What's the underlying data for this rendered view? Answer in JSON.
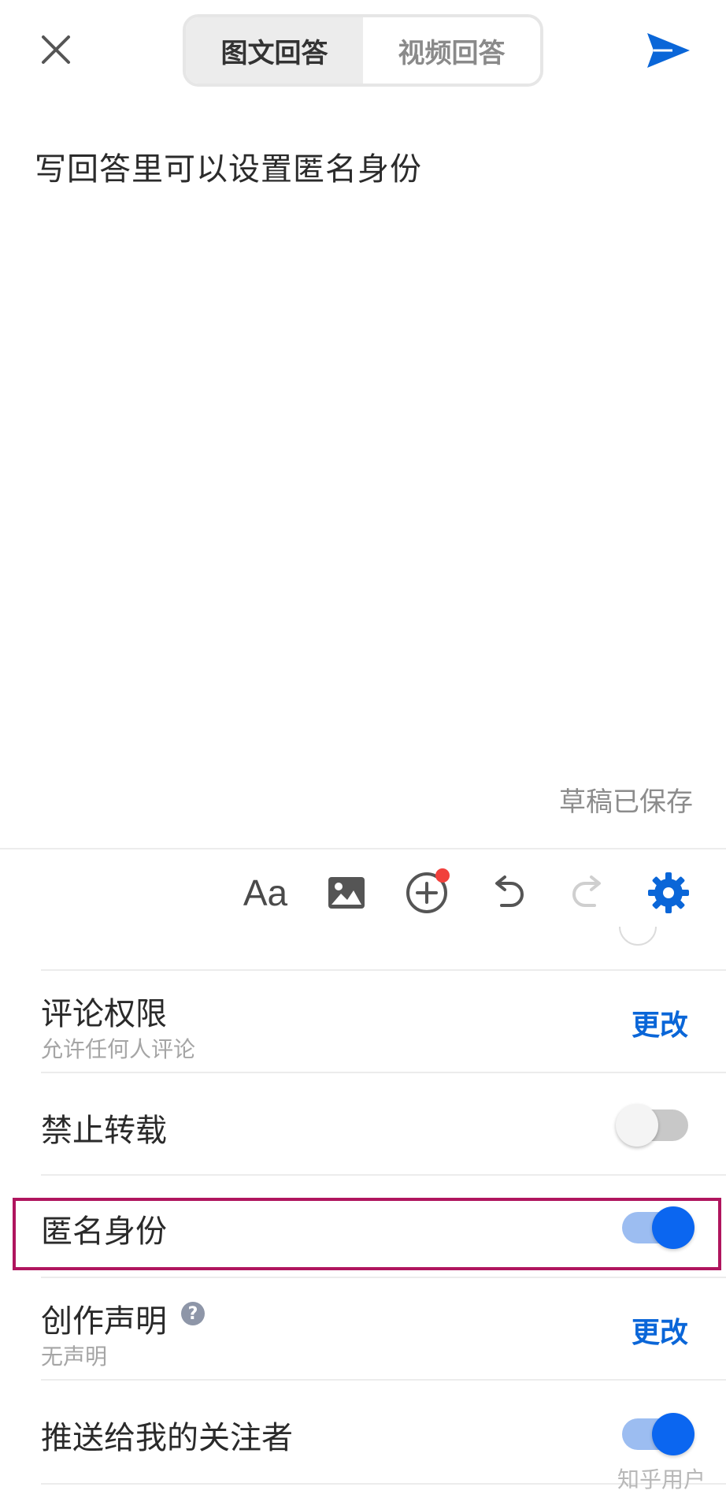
{
  "header": {
    "tabs": [
      {
        "label": "图文回答",
        "active": true
      },
      {
        "label": "视频回答",
        "active": false
      }
    ]
  },
  "editor": {
    "text": "写回答里可以设置匿名身份",
    "draft_status": "草稿已保存"
  },
  "toolbar": {
    "font_label": "Aa"
  },
  "settings": [
    {
      "title": "评论权限",
      "subtitle": "允许任何人评论",
      "action": "更改"
    },
    {
      "title": "禁止转载",
      "toggle": "off"
    },
    {
      "title": "匿名身份",
      "toggle": "on",
      "highlighted": true
    },
    {
      "title": "创作声明",
      "subtitle": "无声明",
      "action": "更改",
      "help_icon": "question-icon",
      "help_glyph": "?"
    },
    {
      "title": "推送给我的关注者",
      "toggle": "on"
    }
  ],
  "watermark": "知乎用户",
  "colors": {
    "accent_blue": "#0a66d8",
    "toggle_on": "#0b66f0",
    "badge_red": "#f1403c",
    "highlight_border": "#b0155e"
  }
}
